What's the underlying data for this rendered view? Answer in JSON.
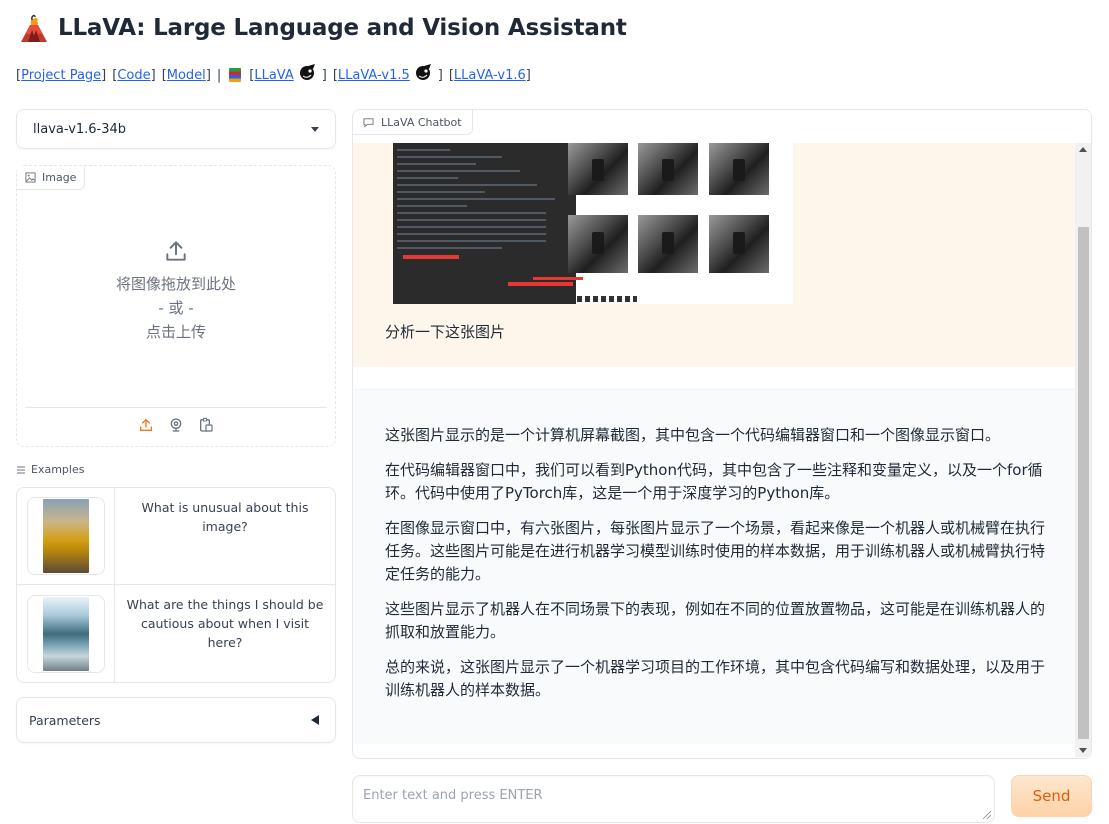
{
  "header": {
    "title": "LLaVA: Large Language and Vision Assistant",
    "links": {
      "project_page": "Project Page",
      "code": "Code",
      "model": "Model",
      "llava": "LLaVA",
      "llava_v15": "LLaVA-v1.5",
      "llava_v16": "LLaVA-v1.6"
    }
  },
  "model_select": {
    "value": "llava-v1.6-34b"
  },
  "image_upload": {
    "label": "Image",
    "drop_text": "将图像拖放到此处",
    "or_text": "- 或 -",
    "click_text": "点击上传"
  },
  "examples": {
    "label": "Examples",
    "items": [
      {
        "text": "What is unusual about this image?"
      },
      {
        "text": "What are the things I should be cautious about when I visit here?"
      }
    ]
  },
  "parameters": {
    "label": "Parameters"
  },
  "chatbot": {
    "label": "LLaVA Chatbot",
    "user_message": "分析一下这张图片",
    "bot_message": [
      "这张图片显示的是一个计算机屏幕截图，其中包含一个代码编辑器窗口和一个图像显示窗口。",
      "在代码编辑器窗口中，我们可以看到Python代码，其中包含了一些注释和变量定义，以及一个for循环。代码中使用了PyTorch库，这是一个用于深度学习的Python库。",
      "在图像显示窗口中，有六张图片，每张图片显示了一个场景，看起来像是一个机器人或机械臂在执行任务。这些图片可能是在进行机器学习模型训练时使用的样本数据，用于训练机器人或机械臂执行特定任务的能力。",
      "这些图片显示了机器人在不同场景下的表现，例如在不同的位置放置物品，这可能是在训练机器人的抓取和放置能力。",
      "总的来说，这张图片显示了一个机器学习项目的工作环境，其中包含代码编写和数据处理，以及用于训练机器人的样本数据。"
    ]
  },
  "input": {
    "placeholder": "Enter text and press ENTER"
  },
  "send_button": {
    "label": "Send"
  },
  "colors": {
    "accent": "#ea580c",
    "user_bubble": "#fef6eb",
    "link": "#2563eb"
  }
}
